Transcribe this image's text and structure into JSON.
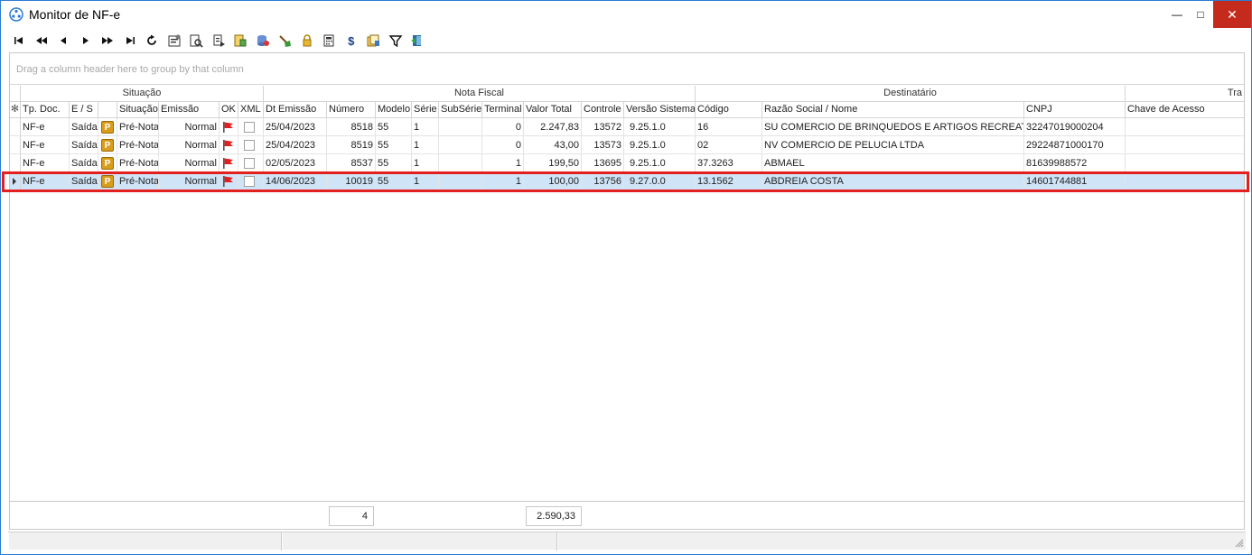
{
  "window": {
    "title": "Monitor de NF-e",
    "min_label": "—",
    "max_label": "□",
    "close_label": "✕"
  },
  "toolbar": {
    "buttons": [
      {
        "name": "first-record",
        "glyph": "⏮"
      },
      {
        "name": "prev-page",
        "glyph": "⏪"
      },
      {
        "name": "prev-record",
        "glyph": "◀"
      },
      {
        "name": "next-record",
        "glyph": "▶"
      },
      {
        "name": "next-page",
        "glyph": "⏩"
      },
      {
        "name": "last-record",
        "glyph": "⏭"
      },
      {
        "name": "refresh",
        "glyph": "↻"
      },
      {
        "name": "settings",
        "glyph": ""
      },
      {
        "name": "preview",
        "glyph": ""
      },
      {
        "name": "export",
        "glyph": ""
      },
      {
        "name": "transmit",
        "glyph": ""
      },
      {
        "name": "database",
        "glyph": ""
      },
      {
        "name": "clean",
        "glyph": ""
      },
      {
        "name": "lock",
        "glyph": ""
      },
      {
        "name": "calculator",
        "glyph": ""
      },
      {
        "name": "dollar",
        "glyph": "$"
      },
      {
        "name": "documents",
        "glyph": ""
      },
      {
        "name": "filter",
        "glyph": ""
      },
      {
        "name": "exit",
        "glyph": ""
      }
    ]
  },
  "grid": {
    "group_hint": "Drag a column header here to group by that column",
    "bands": {
      "situacao": "Situação",
      "nota_fiscal": "Nota Fiscal",
      "destinatario": "Destinatário",
      "transporte": "Tra"
    },
    "columns": {
      "tp_doc": "Tp. Doc.",
      "es": "E / S",
      "icon": "",
      "situacao": "Situação",
      "emissao": "Emissão",
      "ok": "OK",
      "xml": "XML",
      "dt_emissao": "Dt Emissão",
      "numero": "Número",
      "modelo": "Modelo",
      "serie": "Série",
      "subserie": "SubSérie",
      "terminal": "Terminal",
      "valor_total": "Valor Total",
      "controle": "Controle",
      "versao": "Versão Sistema",
      "codigo": "Código",
      "razao": "Razão Social / Nome",
      "cnpj": "CNPJ",
      "chave": "Chave de Acesso"
    },
    "rows": [
      {
        "tp_doc": "NF-e",
        "es": "Saída",
        "badge": "P",
        "situacao": "Pré-Nota",
        "emissao": "Normal",
        "dt_emissao": "25/04/2023",
        "numero": "8518",
        "modelo": "55",
        "serie": "1",
        "subserie": "",
        "terminal": "0",
        "valor_total": "2.247,83",
        "controle": "13572",
        "versao": "9.25.1.0",
        "codigo": "16",
        "razao": "SU COMERCIO DE BRINQUEDOS E ARTIGOS RECREATIVOS",
        "cnpj": "32247019000204",
        "chave": ""
      },
      {
        "tp_doc": "NF-e",
        "es": "Saída",
        "badge": "P",
        "situacao": "Pré-Nota",
        "emissao": "Normal",
        "dt_emissao": "25/04/2023",
        "numero": "8519",
        "modelo": "55",
        "serie": "1",
        "subserie": "",
        "terminal": "0",
        "valor_total": "43,00",
        "controle": "13573",
        "versao": "9.25.1.0",
        "codigo": "02",
        "razao": "NV COMERCIO DE PELUCIA LTDA",
        "cnpj": "29224871000170",
        "chave": ""
      },
      {
        "tp_doc": "NF-e",
        "es": "Saída",
        "badge": "P",
        "situacao": "Pré-Nota",
        "emissao": "Normal",
        "dt_emissao": "02/05/2023",
        "numero": "8537",
        "modelo": "55",
        "serie": "1",
        "subserie": "",
        "terminal": "1",
        "valor_total": "199,50",
        "controle": "13695",
        "versao": "9.25.1.0",
        "codigo": "37.3263",
        "razao": "ABMAEL",
        "cnpj": "81639988572",
        "chave": ""
      },
      {
        "tp_doc": "NF-e",
        "es": "Saída",
        "badge": "P",
        "situacao": "Pré-Nota",
        "emissao": "Normal",
        "dt_emissao": "14/06/2023",
        "numero": "10019",
        "modelo": "55",
        "serie": "1",
        "subserie": "",
        "terminal": "1",
        "valor_total": "100,00",
        "controle": "13756",
        "versao": "9.27.0.0",
        "codigo": "13.1562",
        "razao": "ABDREIA COSTA",
        "cnpj": "14601744881",
        "chave": ""
      }
    ],
    "selected_row": 3,
    "footer": {
      "count": "4",
      "total": "2.590,33"
    }
  },
  "colors": {
    "badge": "#d99d1d",
    "flag": "#e02020",
    "selected_row": "#cfe4f7",
    "highlight": "#e31f1f",
    "title_border": "#2b7cd3"
  }
}
